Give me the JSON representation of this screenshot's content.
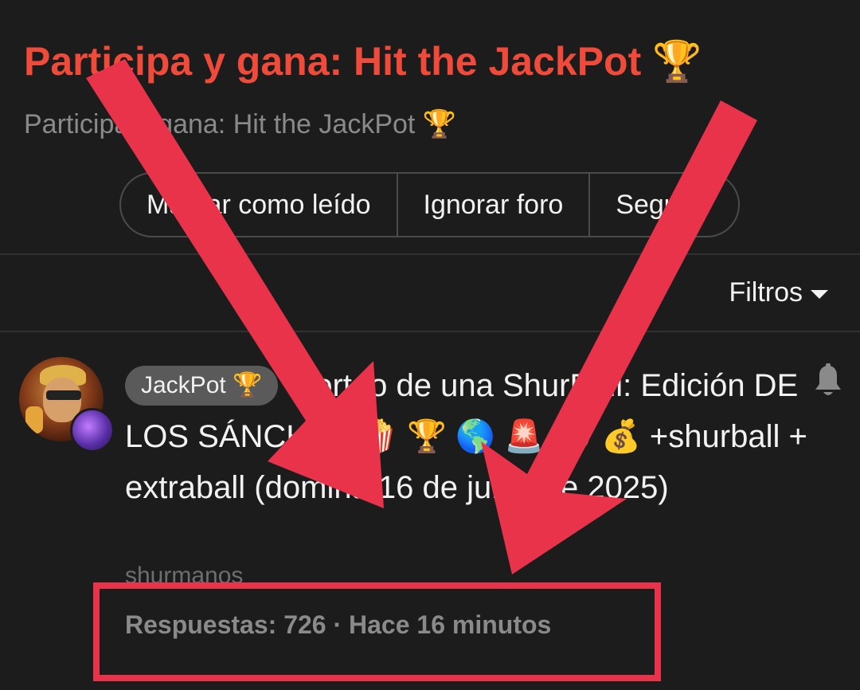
{
  "forum": {
    "title": "Participa y gana: Hit the JackPot 🏆",
    "description": "Participa y gana: Hit the JackPot 🏆"
  },
  "actions": {
    "mark_read": "Marcar como leído",
    "ignore_forum": "Ignorar foro",
    "follow": "Seguir"
  },
  "filters": {
    "label": "Filtros"
  },
  "topic": {
    "prefix": "JackPot 🏆",
    "title": "Sorteo de una ShurBall: Edición DE LOS SÁNCHEZ 🍿 🏆 🌎 🚨 🤑 💰 +shurball + extraball (domina 16 de junio de 2025)",
    "author": "shurmanos",
    "meta": "Respuestas: 726 · Hace 16 minutos"
  },
  "colors": {
    "title_red": "#ef4a3a",
    "annotation_red": "#e8334a",
    "background": "#1c1c1c"
  }
}
